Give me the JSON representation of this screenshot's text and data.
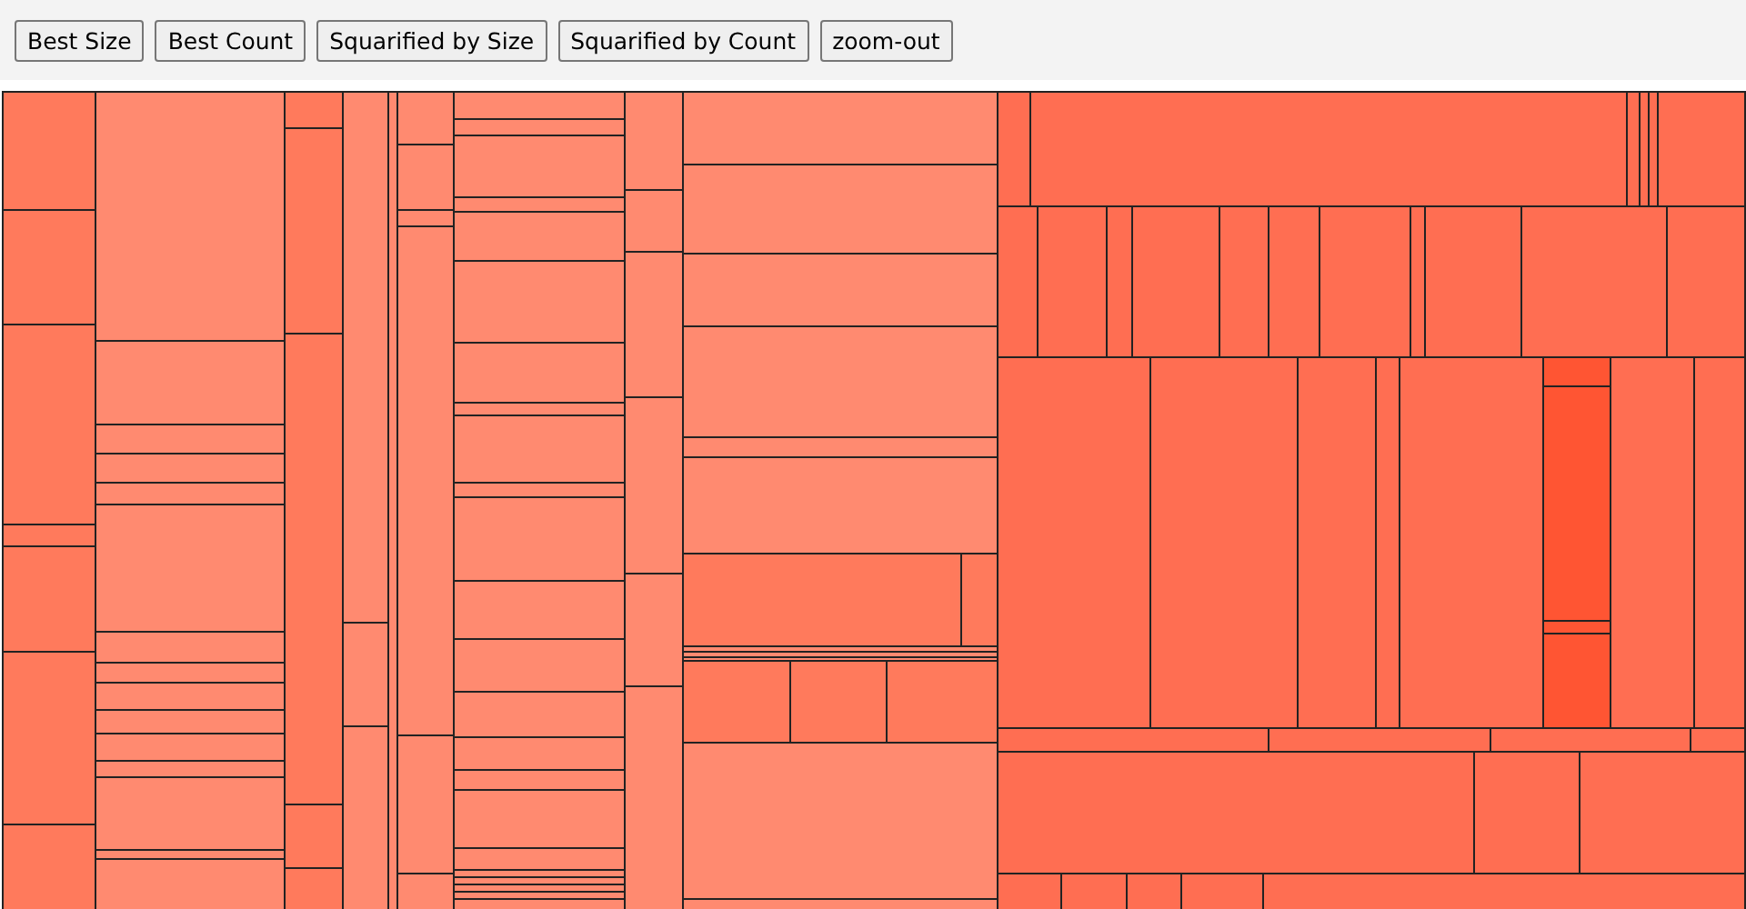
{
  "toolbar": {
    "buttons": [
      {
        "label": "Best Size"
      },
      {
        "label": "Best Count"
      },
      {
        "label": "Squarified by Size"
      },
      {
        "label": "Squarified by Count"
      },
      {
        "label": "zoom-out"
      }
    ]
  }
}
